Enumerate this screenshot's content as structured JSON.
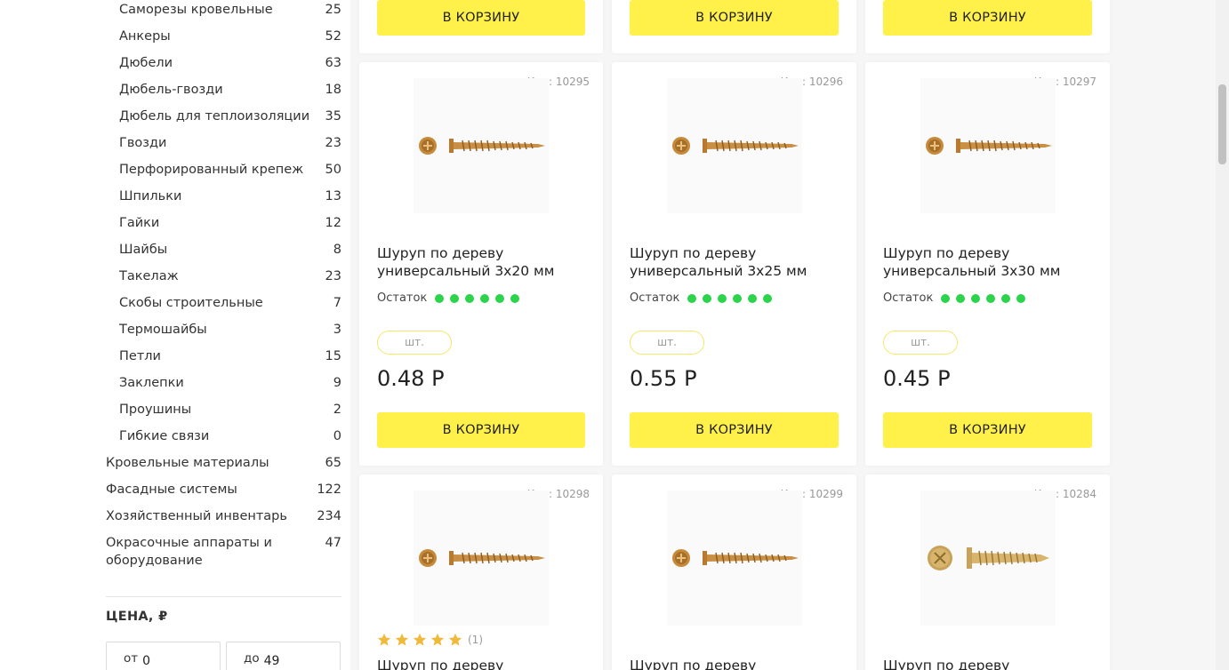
{
  "categories": [
    {
      "name": "Саморезы кровельные",
      "count": "25",
      "sub": true
    },
    {
      "name": "Анкеры",
      "count": "52",
      "sub": true
    },
    {
      "name": "Дюбели",
      "count": "63",
      "sub": true
    },
    {
      "name": "Дюбель-гвозди",
      "count": "18",
      "sub": true
    },
    {
      "name": "Дюбель для теплоизоляции",
      "count": "35",
      "sub": true
    },
    {
      "name": "Гвозди",
      "count": "23",
      "sub": true
    },
    {
      "name": "Перфорированный крепеж",
      "count": "50",
      "sub": true
    },
    {
      "name": "Шпильки",
      "count": "13",
      "sub": true
    },
    {
      "name": "Гайки",
      "count": "12",
      "sub": true
    },
    {
      "name": "Шайбы",
      "count": "8",
      "sub": true
    },
    {
      "name": "Такелаж",
      "count": "23",
      "sub": true
    },
    {
      "name": "Скобы строительные",
      "count": "7",
      "sub": true
    },
    {
      "name": "Термошайбы",
      "count": "3",
      "sub": true
    },
    {
      "name": "Петли",
      "count": "15",
      "sub": true
    },
    {
      "name": "Заклепки",
      "count": "9",
      "sub": true
    },
    {
      "name": "Проушины",
      "count": "2",
      "sub": true
    },
    {
      "name": "Гибкие связи",
      "count": "0",
      "sub": true
    },
    {
      "name": "Кровельные материалы",
      "count": "65",
      "sub": false
    },
    {
      "name": "Фасадные системы",
      "count": "122",
      "sub": false
    },
    {
      "name": "Хозяйственный инвентарь",
      "count": "234",
      "sub": false
    },
    {
      "name": "Окрасочные аппараты и оборудование",
      "count": "47",
      "sub": false
    }
  ],
  "price_filter": {
    "title": "ЦЕНА, ₽",
    "from_label": "от",
    "from_value": "0",
    "to_label": "до",
    "to_value": "49"
  },
  "add_to_cart_label": "В КОРЗИНУ",
  "stock_label": "Остаток",
  "stock_level": 6,
  "unit_label": "шт.",
  "products": [
    {
      "code": "Код: 10295",
      "title": "Шуруп по дереву универсальный 3x20 мм",
      "price": "0.48 Р",
      "image": "wood-screw-image"
    },
    {
      "code": "Код: 10296",
      "title": "Шуруп по дереву универсальный 3x25 мм",
      "price": "0.55 Р",
      "image": "wood-screw-image"
    },
    {
      "code": "Код: 10297",
      "title": "Шуруп по дереву универсальный 3x30 мм",
      "price": "0.45 Р",
      "image": "wood-screw-image"
    },
    {
      "code": "Код: 10298",
      "title": "Шуруп по дереву",
      "rating": "5",
      "rating_count": "(1)",
      "image": "wood-screw-image"
    },
    {
      "code": "Код: 10299",
      "title": "Шуруп по дереву",
      "image": "wood-screw-image"
    },
    {
      "code": "Код: 10284",
      "title": "Шуруп по дереву",
      "image": "wood-screw-image"
    }
  ],
  "colors": {
    "accent_yellow": "#fff04a",
    "stock_green": "#2bd44a",
    "unit_border": "#f5e76b"
  }
}
